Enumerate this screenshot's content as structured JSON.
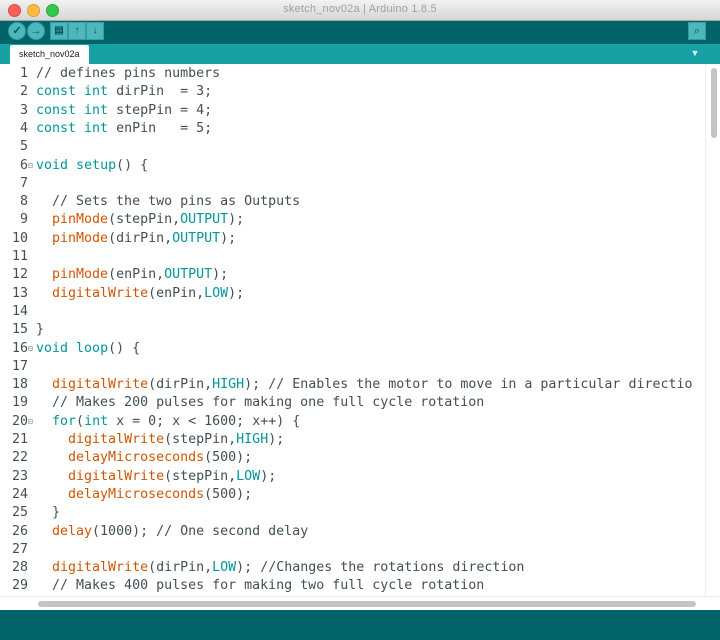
{
  "window": {
    "title": "sketch_nov02a | Arduino 1.8.5"
  },
  "tabs": [
    {
      "label": "sketch_nov02a"
    }
  ],
  "icons": {
    "verify": "checkmark-icon",
    "upload": "arrow-right-icon",
    "new": "new-file-icon",
    "open": "open-arrow-up-icon",
    "save": "save-arrow-down-icon",
    "serial_monitor": "magnifier-icon",
    "tab_menu": "triangle-down-icon"
  },
  "colors": {
    "toolbar": "#006468",
    "tabbar": "#17a1a5",
    "keyword": "#00979c",
    "function": "#d35400",
    "text": "#434f54"
  },
  "code": [
    {
      "n": "1",
      "fold": false,
      "tokens": [
        {
          "t": "cmt",
          "v": "// defines pins numbers"
        }
      ]
    },
    {
      "n": "2",
      "fold": false,
      "tokens": [
        {
          "t": "kw",
          "v": "const"
        },
        {
          "t": "plain",
          "v": " "
        },
        {
          "t": "kw",
          "v": "int"
        },
        {
          "t": "plain",
          "v": " dirPin  = 3;"
        }
      ]
    },
    {
      "n": "3",
      "fold": false,
      "tokens": [
        {
          "t": "kw",
          "v": "const"
        },
        {
          "t": "plain",
          "v": " "
        },
        {
          "t": "kw",
          "v": "int"
        },
        {
          "t": "plain",
          "v": " stepPin = 4;"
        }
      ]
    },
    {
      "n": "4",
      "fold": false,
      "tokens": [
        {
          "t": "kw",
          "v": "const"
        },
        {
          "t": "plain",
          "v": " "
        },
        {
          "t": "kw",
          "v": "int"
        },
        {
          "t": "plain",
          "v": " enPin   = 5;"
        }
      ]
    },
    {
      "n": "5",
      "fold": false,
      "tokens": []
    },
    {
      "n": "6",
      "fold": true,
      "tokens": [
        {
          "t": "kw",
          "v": "void"
        },
        {
          "t": "plain",
          "v": " "
        },
        {
          "t": "kw",
          "v": "setup"
        },
        {
          "t": "plain",
          "v": "() {"
        }
      ]
    },
    {
      "n": "7",
      "fold": false,
      "tokens": []
    },
    {
      "n": "8",
      "fold": false,
      "tokens": [
        {
          "t": "cmt",
          "v": "  // Sets the two pins as Outputs"
        }
      ]
    },
    {
      "n": "9",
      "fold": false,
      "tokens": [
        {
          "t": "plain",
          "v": "  "
        },
        {
          "t": "fn",
          "v": "pinMode"
        },
        {
          "t": "plain",
          "v": "(stepPin,"
        },
        {
          "t": "const",
          "v": "OUTPUT"
        },
        {
          "t": "plain",
          "v": ");"
        }
      ]
    },
    {
      "n": "10",
      "fold": false,
      "tokens": [
        {
          "t": "plain",
          "v": "  "
        },
        {
          "t": "fn",
          "v": "pinMode"
        },
        {
          "t": "plain",
          "v": "(dirPin,"
        },
        {
          "t": "const",
          "v": "OUTPUT"
        },
        {
          "t": "plain",
          "v": ");"
        }
      ]
    },
    {
      "n": "11",
      "fold": false,
      "tokens": []
    },
    {
      "n": "12",
      "fold": false,
      "tokens": [
        {
          "t": "plain",
          "v": "  "
        },
        {
          "t": "fn",
          "v": "pinMode"
        },
        {
          "t": "plain",
          "v": "(enPin,"
        },
        {
          "t": "const",
          "v": "OUTPUT"
        },
        {
          "t": "plain",
          "v": ");"
        }
      ]
    },
    {
      "n": "13",
      "fold": false,
      "tokens": [
        {
          "t": "plain",
          "v": "  "
        },
        {
          "t": "fn",
          "v": "digitalWrite"
        },
        {
          "t": "plain",
          "v": "(enPin,"
        },
        {
          "t": "const",
          "v": "LOW"
        },
        {
          "t": "plain",
          "v": ");"
        }
      ]
    },
    {
      "n": "14",
      "fold": false,
      "tokens": []
    },
    {
      "n": "15",
      "fold": false,
      "tokens": [
        {
          "t": "plain",
          "v": "}"
        }
      ]
    },
    {
      "n": "16",
      "fold": true,
      "tokens": [
        {
          "t": "kw",
          "v": "void"
        },
        {
          "t": "plain",
          "v": " "
        },
        {
          "t": "kw",
          "v": "loop"
        },
        {
          "t": "plain",
          "v": "() {"
        }
      ]
    },
    {
      "n": "17",
      "fold": false,
      "tokens": []
    },
    {
      "n": "18",
      "fold": false,
      "tokens": [
        {
          "t": "plain",
          "v": "  "
        },
        {
          "t": "fn",
          "v": "digitalWrite"
        },
        {
          "t": "plain",
          "v": "(dirPin,"
        },
        {
          "t": "const",
          "v": "HIGH"
        },
        {
          "t": "plain",
          "v": "); "
        },
        {
          "t": "cmt",
          "v": "// Enables the motor to move in a particular directio"
        }
      ]
    },
    {
      "n": "19",
      "fold": false,
      "tokens": [
        {
          "t": "cmt",
          "v": "  // Makes 200 pulses for making one full cycle rotation"
        }
      ]
    },
    {
      "n": "20",
      "fold": true,
      "tokens": [
        {
          "t": "plain",
          "v": "  "
        },
        {
          "t": "kw",
          "v": "for"
        },
        {
          "t": "plain",
          "v": "("
        },
        {
          "t": "kw",
          "v": "int"
        },
        {
          "t": "plain",
          "v": " x = 0; x < 1600; x++) {"
        }
      ]
    },
    {
      "n": "21",
      "fold": false,
      "tokens": [
        {
          "t": "plain",
          "v": "    "
        },
        {
          "t": "fn",
          "v": "digitalWrite"
        },
        {
          "t": "plain",
          "v": "(stepPin,"
        },
        {
          "t": "const",
          "v": "HIGH"
        },
        {
          "t": "plain",
          "v": ");"
        }
      ]
    },
    {
      "n": "22",
      "fold": false,
      "tokens": [
        {
          "t": "plain",
          "v": "    "
        },
        {
          "t": "fn",
          "v": "delayMicroseconds"
        },
        {
          "t": "plain",
          "v": "(500);"
        }
      ]
    },
    {
      "n": "23",
      "fold": false,
      "tokens": [
        {
          "t": "plain",
          "v": "    "
        },
        {
          "t": "fn",
          "v": "digitalWrite"
        },
        {
          "t": "plain",
          "v": "(stepPin,"
        },
        {
          "t": "const",
          "v": "LOW"
        },
        {
          "t": "plain",
          "v": ");"
        }
      ]
    },
    {
      "n": "24",
      "fold": false,
      "tokens": [
        {
          "t": "plain",
          "v": "    "
        },
        {
          "t": "fn",
          "v": "delayMicroseconds"
        },
        {
          "t": "plain",
          "v": "(500);"
        }
      ]
    },
    {
      "n": "25",
      "fold": false,
      "tokens": [
        {
          "t": "plain",
          "v": "  }"
        }
      ]
    },
    {
      "n": "26",
      "fold": false,
      "tokens": [
        {
          "t": "plain",
          "v": "  "
        },
        {
          "t": "fn",
          "v": "delay"
        },
        {
          "t": "plain",
          "v": "(1000); "
        },
        {
          "t": "cmt",
          "v": "// One second delay"
        }
      ]
    },
    {
      "n": "27",
      "fold": false,
      "tokens": []
    },
    {
      "n": "28",
      "fold": false,
      "tokens": [
        {
          "t": "plain",
          "v": "  "
        },
        {
          "t": "fn",
          "v": "digitalWrite"
        },
        {
          "t": "plain",
          "v": "(dirPin,"
        },
        {
          "t": "const",
          "v": "LOW"
        },
        {
          "t": "plain",
          "v": "); "
        },
        {
          "t": "cmt",
          "v": "//Changes the rotations direction"
        }
      ]
    },
    {
      "n": "29",
      "fold": false,
      "tokens": [
        {
          "t": "cmt",
          "v": "  // Makes 400 pulses for making two full cycle rotation"
        }
      ]
    }
  ]
}
